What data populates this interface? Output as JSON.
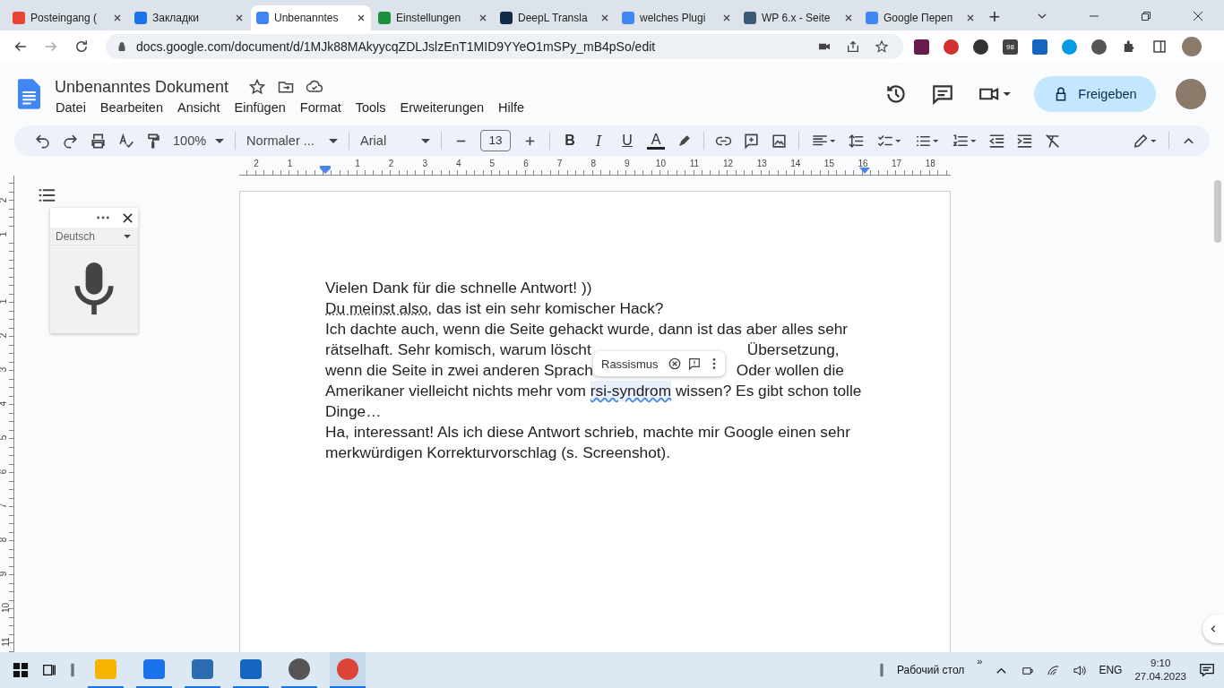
{
  "browser": {
    "tabs": [
      {
        "title": "Posteingang (",
        "selected": false
      },
      {
        "title": "Закладки",
        "selected": false
      },
      {
        "title": "Unbenanntes",
        "selected": true
      },
      {
        "title": "Einstellungen",
        "selected": false
      },
      {
        "title": "DeepL Transla",
        "selected": false
      },
      {
        "title": "welches Plugi",
        "selected": false
      },
      {
        "title": "WP 6.x - Seite",
        "selected": false
      },
      {
        "title": "Google Переп",
        "selected": false
      }
    ],
    "new_tab": "+",
    "url": "docs.google.com/document/d/1MJk88MAkyycqZDLJslzEnT1MID9YYeO1mSPy_mB4pSo/edit",
    "extension_badges": [
      "98"
    ]
  },
  "docs": {
    "title": "Unbenanntes Dokument",
    "menu": [
      "Datei",
      "Bearbeiten",
      "Ansicht",
      "Einfügen",
      "Format",
      "Tools",
      "Erweiterungen",
      "Hilfe"
    ],
    "share_button": "Freigeben",
    "toolbar": {
      "zoom": "100%",
      "style": "Normaler ...",
      "font": "Arial",
      "font_size": "13",
      "bold": "B",
      "italic": "I",
      "underline": "U",
      "text_color": "A"
    },
    "ruler": {
      "labels": [
        "2",
        "1",
        "1",
        "2",
        "3",
        "4",
        "5",
        "6",
        "7",
        "8",
        "9",
        "10",
        "11",
        "12",
        "13",
        "14",
        "15",
        "16",
        "17",
        "18"
      ]
    },
    "vertical_ruler": {
      "labels": [
        "2",
        "1",
        "1",
        "2",
        "3",
        "4",
        "5",
        "6",
        "7",
        "8",
        "9",
        "10",
        "11"
      ]
    },
    "voice_typing": {
      "language": "Deutsch"
    },
    "lines": [
      [
        {
          "kind": "plain",
          "text": "Vielen Dank für die schnelle Antwort! ))"
        }
      ],
      [
        {
          "kind": "grammar",
          "text": "Du meinst also,"
        },
        {
          "kind": "plain",
          "text": " das ist ein sehr komischer Hack?"
        }
      ],
      [
        {
          "kind": "plain",
          "text": "Ich dachte auch, wenn die Seite gehackt wurde, dann ist das aber alles sehr"
        }
      ],
      [
        {
          "kind": "plain",
          "text": "rätselhaft. Sehr komisch, warum löscht"
        },
        {
          "kind": "covered"
        },
        {
          "kind": "plain",
          "text": "Übersetzung,"
        }
      ],
      [
        {
          "kind": "plain",
          "text": "wenn die Seite in zwei anderen Sprach"
        },
        {
          "kind": "covered"
        },
        {
          "kind": "plain",
          "text": "Oder wollen die"
        }
      ],
      [
        {
          "kind": "plain",
          "text": "Amerikaner vielleicht nichts mehr vom "
        },
        {
          "kind": "spelling",
          "text": "rsi-syndrom"
        },
        {
          "kind": "plain",
          "text": " wissen? Es gibt schon tolle"
        }
      ],
      [
        {
          "kind": "plain",
          "text": "Dinge…"
        }
      ],
      [
        {
          "kind": "plain",
          "text": "Ha, interessant! Als ich diese Antwort schrieb, machte mir Google einen sehr"
        }
      ],
      [
        {
          "kind": "plain",
          "text": "merkwürdigen Korrekturvorschlag (s. Screenshot)."
        }
      ]
    ],
    "suggestion": {
      "text": "Rassismus"
    }
  },
  "taskbar": {
    "apps": [
      {
        "selected": false
      },
      {
        "selected": false
      },
      {
        "selected": false
      },
      {
        "selected": false
      },
      {
        "selected": false
      },
      {
        "selected": true
      }
    ],
    "desktop_label": "Рабочий стол",
    "overflow": "»",
    "language": "ENG",
    "time": "9:10",
    "date": "27.04.2023"
  }
}
